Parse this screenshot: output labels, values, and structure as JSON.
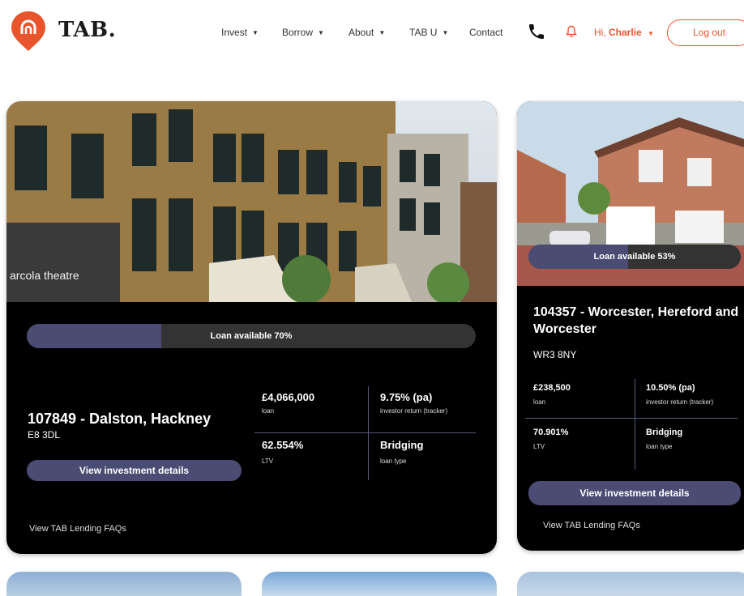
{
  "brand": {
    "name": "TAB.",
    "accent": "#e8542c"
  },
  "nav": {
    "items": [
      {
        "label": "Invest",
        "caret": "▼"
      },
      {
        "label": "Borrow",
        "caret": "▼"
      },
      {
        "label": "About",
        "caret": "▼"
      },
      {
        "label": "TAB U",
        "caret": "▼"
      },
      {
        "label": "Contact",
        "caret": ""
      }
    ],
    "greeting_prefix": "Hi, ",
    "user_name": "Charlie",
    "logout_label": "Log out"
  },
  "cards": [
    {
      "image_caption": "arcola theatre",
      "loan_available_label": "Loan available 70%",
      "loan_available_percent": 70,
      "title": "107849 - Dalston, Hackney",
      "postcode": "E8 3DL",
      "loan_value": "£4,066,000",
      "loan_label": "loan",
      "return_value": "9.75% (pa)",
      "return_label": "investor return (tracker)",
      "ltv_value": "62.554%",
      "ltv_label": "LTV",
      "type_value": "Bridging",
      "type_label": "loan type",
      "button_label": "View investment details",
      "faq_label": "View TAB Lending FAQs"
    },
    {
      "loan_available_label": "Loan available 53%",
      "loan_available_percent": 53,
      "title": "104357 - Worcester, Hereford and Worcester",
      "postcode": "WR3 8NY",
      "loan_value": "£238,500",
      "loan_label": "loan",
      "return_value": "10.50% (pa)",
      "return_label": "investor return (tracker)",
      "ltv_value": "70.901%",
      "ltv_label": "LTV",
      "type_value": "Bridging",
      "type_label": "loan type",
      "button_label": "View investment details",
      "faq_label": "View TAB Lending FAQs"
    }
  ]
}
